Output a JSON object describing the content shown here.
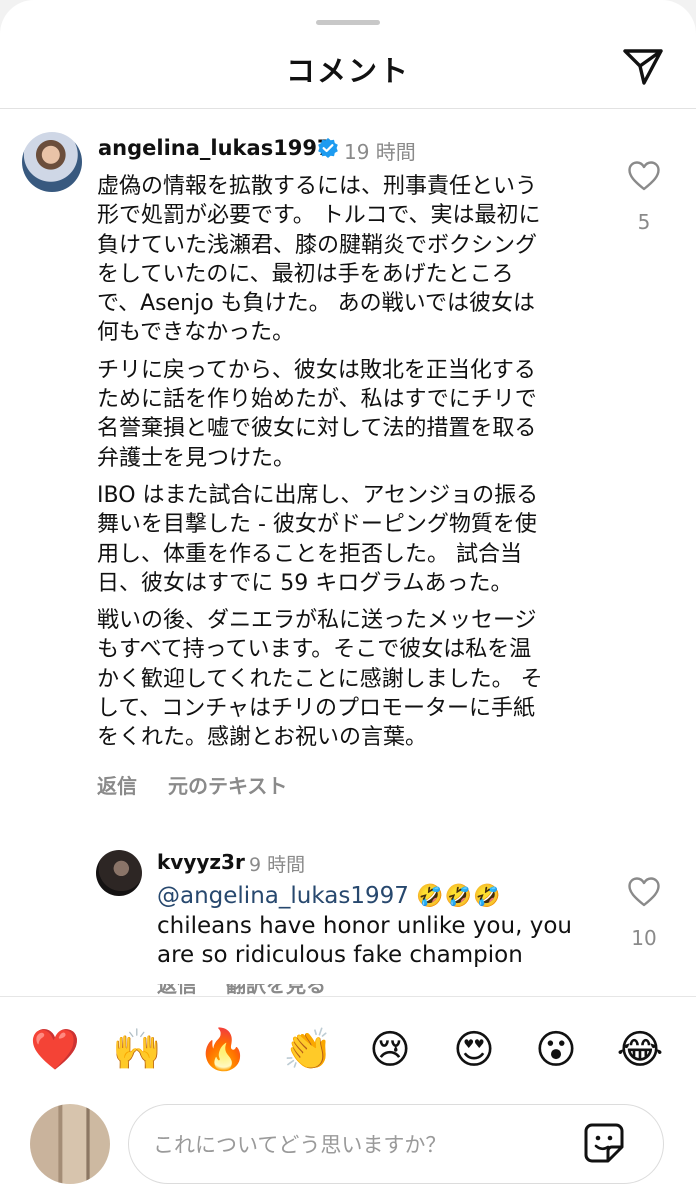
{
  "header": {
    "title": "コメント"
  },
  "comment": {
    "username": "angelina_lukas1997",
    "time": "19 時間",
    "paragraphs": [
      "虚偽の情報を拡散するには、刑事責任という\n形で処罰が必要です。 トルコで、実は最初に\n負けていた浅瀬君、膝の腱鞘炎でボクシング\nをしていたのに、最初は手をあげたところ\nで、Asenjo も負けた。 あの戦いでは彼女は\n何もできなかった。",
      "チリに戻ってから、彼女は敗北を正当化する\nために話を作り始めたが、私はすでにチリで\n名誉棄損と嘘で彼女に対して法的措置を取る\n弁護士を見つけた。",
      "IBO はまた試合に出席し、アセンジョの振る\n舞いを目撃した - 彼女がドーピング物質を使\n用し、体重を作ることを拒否した。 試合当\n日、彼女はすでに 59 キログラムあった。",
      "戦いの後、ダニエラが私に送ったメッセージ\nもすべて持っています。そこで彼女は私を温\nかく歓迎してくれたことに感謝しました。 そ\nして、コンチャはチリのプロモーターに手紙\nをくれた。感謝とお祝いの言葉。"
    ],
    "like_count": "5",
    "reply_label": "返信",
    "see_original_label": "元のテキスト"
  },
  "reply": {
    "username": "kvyyz3r",
    "time": "9 時間",
    "mention": "@angelina_lukas1997",
    "emojis": "🤣🤣🤣",
    "text": "chileans have honor unlike you, you are so ridiculous fake champion",
    "like_count": "10",
    "reply_label": "返信",
    "translation_label": "翻訳を見る"
  },
  "reactions": [
    "❤️",
    "🙌",
    "🔥",
    "👏",
    "😢",
    "😍",
    "😮",
    "😂"
  ],
  "input": {
    "placeholder": "これについてどう思いますか？"
  },
  "colors": {
    "link": "#27486e",
    "muted": "#8a8a8a",
    "verified": "#1d9bf0"
  }
}
